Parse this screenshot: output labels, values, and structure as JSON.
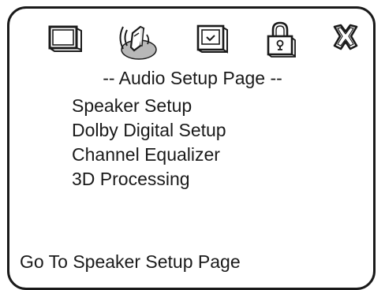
{
  "page": {
    "title": "-- Audio Setup Page --"
  },
  "icons": [
    {
      "name": "tv-icon",
      "label": "General Setup"
    },
    {
      "name": "audio-speaker-icon",
      "label": "Audio Setup",
      "selected": true
    },
    {
      "name": "video-screen-icon",
      "label": "Video Setup"
    },
    {
      "name": "lock-icon",
      "label": "Password Setup"
    },
    {
      "name": "exit-icon",
      "label": "Exit"
    }
  ],
  "menu": {
    "items": [
      {
        "label": "Speaker Setup"
      },
      {
        "label": "Dolby Digital Setup"
      },
      {
        "label": "Channel Equalizer"
      },
      {
        "label": "3D Processing"
      }
    ]
  },
  "status": {
    "text": "Go To Speaker Setup Page"
  },
  "colors": {
    "ink": "#1a1a1a",
    "background": "#ffffff"
  }
}
